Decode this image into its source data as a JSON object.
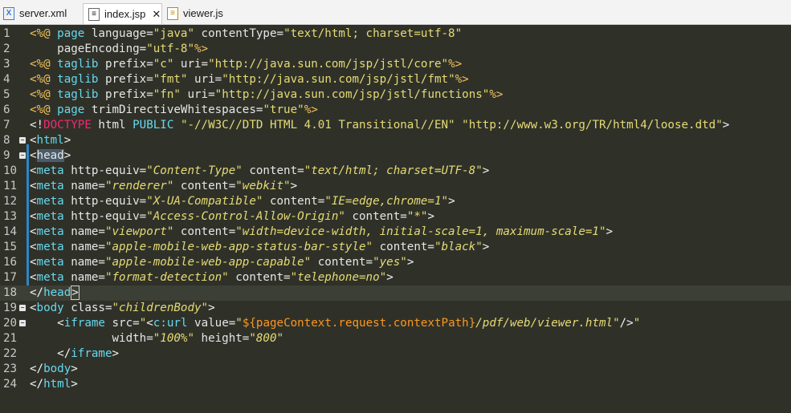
{
  "tabs": [
    {
      "label": "server.xml",
      "icon": "xml-file-icon",
      "active": false
    },
    {
      "label": "index.jsp",
      "icon": "jsp-file-icon",
      "active": true,
      "close": "✕"
    },
    {
      "label": "viewer.js",
      "icon": "js-file-icon",
      "active": false
    }
  ],
  "editor": {
    "current_line": 18,
    "fold_markers": [
      8,
      9,
      19,
      20
    ],
    "lines": [
      {
        "n": "1",
        "segs": [
          [
            "d",
            "<%@ "
          ],
          [
            "k",
            "page"
          ],
          [
            "a",
            " language="
          ],
          [
            "s",
            "\"java\""
          ],
          [
            "a",
            " contentType="
          ],
          [
            "s",
            "\"text/html; charset=utf-8\""
          ]
        ]
      },
      {
        "n": "2",
        "segs": [
          [
            "a",
            "    pageEncoding="
          ],
          [
            "s",
            "\"utf-8\""
          ],
          [
            "d",
            "%>"
          ]
        ]
      },
      {
        "n": "3",
        "segs": [
          [
            "d",
            "<%@ "
          ],
          [
            "k",
            "taglib"
          ],
          [
            "a",
            " prefix="
          ],
          [
            "s",
            "\"c\""
          ],
          [
            "a",
            " uri="
          ],
          [
            "s",
            "\"http://java.sun.com/jsp/jstl/core\""
          ],
          [
            "d",
            "%>"
          ]
        ]
      },
      {
        "n": "4",
        "segs": [
          [
            "d",
            "<%@ "
          ],
          [
            "k",
            "taglib"
          ],
          [
            "a",
            " prefix="
          ],
          [
            "s",
            "\"fmt\""
          ],
          [
            "a",
            " uri="
          ],
          [
            "s",
            "\"http://java.sun.com/jsp/jstl/fmt\""
          ],
          [
            "d",
            "%>"
          ]
        ]
      },
      {
        "n": "5",
        "segs": [
          [
            "d",
            "<%@ "
          ],
          [
            "k",
            "taglib"
          ],
          [
            "a",
            " prefix="
          ],
          [
            "s",
            "\"fn\""
          ],
          [
            "a",
            " uri="
          ],
          [
            "s",
            "\"http://java.sun.com/jsp/jstl/functions\""
          ],
          [
            "d",
            "%>"
          ]
        ]
      },
      {
        "n": "6",
        "segs": [
          [
            "d",
            "<%@ "
          ],
          [
            "k",
            "page"
          ],
          [
            "a",
            " trimDirectiveWhitespaces="
          ],
          [
            "s",
            "\"true\""
          ],
          [
            "d",
            "%>"
          ]
        ]
      },
      {
        "n": "7",
        "segs": [
          [
            "p",
            "<!"
          ],
          [
            "tg",
            "DOCTYPE"
          ],
          [
            "a",
            " html "
          ],
          [
            "k",
            "PUBLIC"
          ],
          [
            "a",
            " "
          ],
          [
            "s",
            "\"-//W3C//DTD HTML 4.01 Transitional//EN\""
          ],
          [
            "a",
            " "
          ],
          [
            "s",
            "\"http://www.w3.org/TR/html4/loose.dtd\""
          ],
          [
            "p",
            ">"
          ]
        ]
      },
      {
        "n": "8",
        "segs": [
          [
            "p",
            "<"
          ],
          [
            "t",
            "html"
          ],
          [
            "p",
            ">"
          ]
        ]
      },
      {
        "n": "9",
        "segs": [
          [
            "p",
            "<"
          ],
          [
            "sel",
            "head"
          ],
          [
            "p",
            ">"
          ]
        ]
      },
      {
        "n": "10",
        "segs": [
          [
            "p",
            "<"
          ],
          [
            "t",
            "meta"
          ],
          [
            "a",
            " http-equiv="
          ],
          [
            "si",
            "\"Content-Type\""
          ],
          [
            "a",
            " content="
          ],
          [
            "si",
            "\"text/html; charset=UTF-8\""
          ],
          [
            "p",
            ">"
          ]
        ]
      },
      {
        "n": "11",
        "segs": [
          [
            "p",
            "<"
          ],
          [
            "t",
            "meta"
          ],
          [
            "a",
            " name="
          ],
          [
            "si",
            "\"renderer\""
          ],
          [
            "a",
            " content="
          ],
          [
            "si",
            "\"webkit\""
          ],
          [
            "p",
            ">"
          ]
        ]
      },
      {
        "n": "12",
        "segs": [
          [
            "p",
            "<"
          ],
          [
            "t",
            "meta"
          ],
          [
            "a",
            " http-equiv="
          ],
          [
            "si",
            "\"X-UA-Compatible\""
          ],
          [
            "a",
            " content="
          ],
          [
            "si",
            "\"IE=edge,chrome=1\""
          ],
          [
            "p",
            ">"
          ]
        ]
      },
      {
        "n": "13",
        "segs": [
          [
            "p",
            "<"
          ],
          [
            "t",
            "meta"
          ],
          [
            "a",
            " http-equiv="
          ],
          [
            "si",
            "\"Access-Control-Allow-Origin\""
          ],
          [
            "a",
            " content="
          ],
          [
            "si",
            "\"*\""
          ],
          [
            "p",
            ">"
          ]
        ]
      },
      {
        "n": "14",
        "segs": [
          [
            "p",
            "<"
          ],
          [
            "t",
            "meta"
          ],
          [
            "a",
            " name="
          ],
          [
            "si",
            "\"viewport\""
          ],
          [
            "a",
            " content="
          ],
          [
            "si",
            "\"width=device-width, initial-scale=1, maximum-scale=1\""
          ],
          [
            "p",
            ">"
          ]
        ]
      },
      {
        "n": "15",
        "segs": [
          [
            "p",
            "<"
          ],
          [
            "t",
            "meta"
          ],
          [
            "a",
            " name="
          ],
          [
            "si",
            "\"apple-mobile-web-app-status-bar-style\""
          ],
          [
            "a",
            " content="
          ],
          [
            "si",
            "\"black\""
          ],
          [
            "p",
            ">"
          ]
        ]
      },
      {
        "n": "16",
        "segs": [
          [
            "p",
            "<"
          ],
          [
            "t",
            "meta"
          ],
          [
            "a",
            " name="
          ],
          [
            "si",
            "\"apple-mobile-web-app-capable\""
          ],
          [
            "a",
            " content="
          ],
          [
            "si",
            "\"yes\""
          ],
          [
            "p",
            ">"
          ]
        ]
      },
      {
        "n": "17",
        "segs": [
          [
            "p",
            "<"
          ],
          [
            "t",
            "meta"
          ],
          [
            "a",
            " name="
          ],
          [
            "si",
            "\"format-detection\""
          ],
          [
            "a",
            " content="
          ],
          [
            "si",
            "\"telephone=no\""
          ],
          [
            "p",
            ">"
          ]
        ]
      },
      {
        "n": "18",
        "segs": [
          [
            "p",
            "</"
          ],
          [
            "t",
            "head"
          ],
          [
            "brk",
            ">"
          ]
        ]
      },
      {
        "n": "19",
        "segs": [
          [
            "p",
            "<"
          ],
          [
            "t",
            "body"
          ],
          [
            "a",
            " class="
          ],
          [
            "si",
            "\"childrenBody\""
          ],
          [
            "p",
            ">"
          ]
        ]
      },
      {
        "n": "20",
        "segs": [
          [
            "a",
            "    "
          ],
          [
            "p",
            "<"
          ],
          [
            "t",
            "iframe"
          ],
          [
            "a",
            " src="
          ],
          [
            "si",
            "\""
          ],
          [
            "p",
            "<"
          ],
          [
            "t",
            "c:url"
          ],
          [
            "a",
            " value="
          ],
          [
            "si",
            "\""
          ],
          [
            "v",
            "${pageContext.request.contextPath}"
          ],
          [
            "si",
            "/pdf/web/viewer.html\""
          ],
          [
            "p",
            "/>"
          ],
          [
            "si",
            "\""
          ]
        ]
      },
      {
        "n": "21",
        "segs": [
          [
            "a",
            "            width="
          ],
          [
            "si",
            "\"100%\""
          ],
          [
            "a",
            " height="
          ],
          [
            "si",
            "\"800\""
          ]
        ]
      },
      {
        "n": "22",
        "segs": [
          [
            "a",
            "    "
          ],
          [
            "p",
            "</"
          ],
          [
            "t",
            "iframe"
          ],
          [
            "p",
            ">"
          ]
        ]
      },
      {
        "n": "23",
        "segs": [
          [
            "p",
            "</"
          ],
          [
            "t",
            "body"
          ],
          [
            "p",
            ">"
          ]
        ]
      },
      {
        "n": "24",
        "segs": [
          [
            "p",
            "</"
          ],
          [
            "t",
            "html"
          ],
          [
            "p",
            ">"
          ]
        ]
      }
    ]
  }
}
